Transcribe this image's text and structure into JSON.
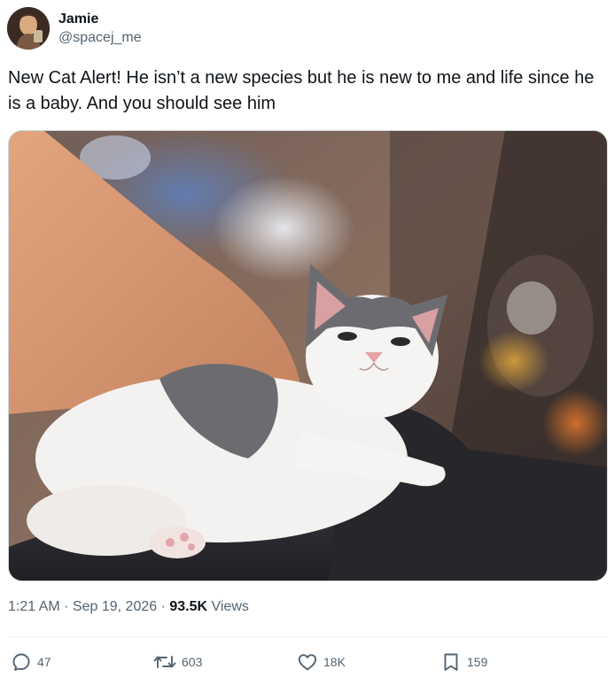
{
  "author": {
    "display_name": "Jamie",
    "handle": "@spacej_me"
  },
  "tweet": {
    "text": "New Cat Alert! He isn’t a new species but he is new to me and life since he is a baby. And you should see him",
    "time": "1:21 AM",
    "separator": "·",
    "date": "Sep 19, 2026",
    "views_count": "93.5K",
    "views_label": "Views"
  },
  "actions": {
    "replies": "47",
    "reposts": "603",
    "likes": "18K",
    "bookmarks": "159"
  },
  "icons": {
    "reply": "reply-icon",
    "repost": "repost-icon",
    "like": "heart-icon",
    "bookmark": "bookmark-icon"
  },
  "colors": {
    "text_primary": "#0f1419",
    "text_secondary": "#536471",
    "divider": "#eff3f4"
  }
}
